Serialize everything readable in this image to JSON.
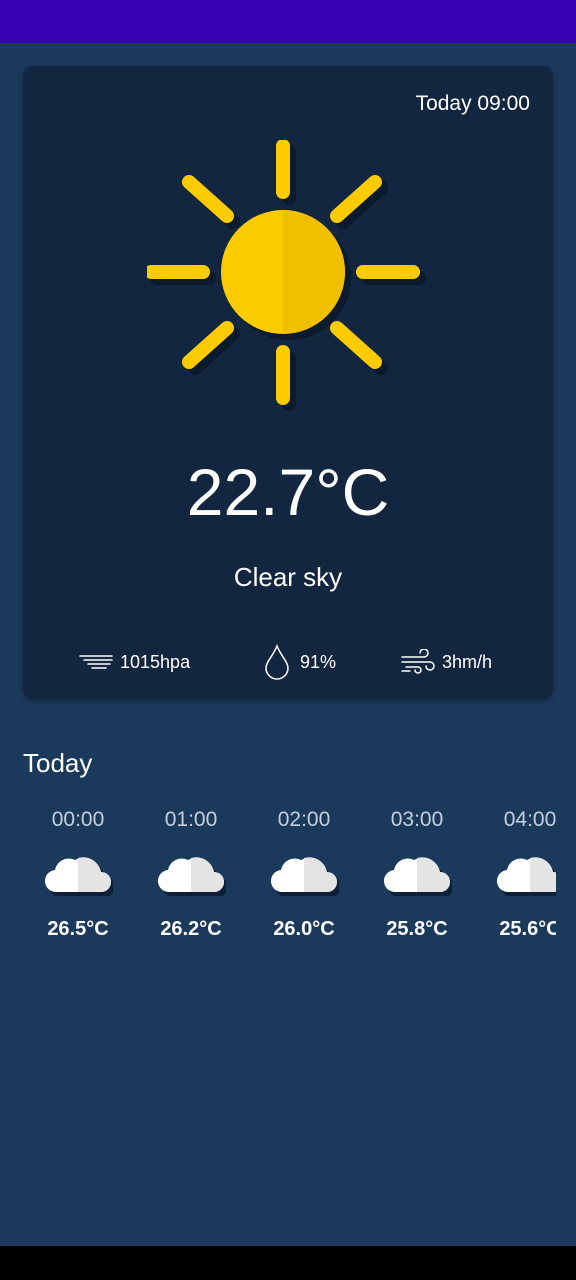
{
  "current": {
    "datetime": "Today 09:00",
    "weather_icon": "sun-icon",
    "temperature": "22.7°C",
    "condition": "Clear sky",
    "pressure": "1015hpa",
    "humidity": "91%",
    "wind": "3hm/h"
  },
  "hourly": {
    "title": "Today",
    "items": [
      {
        "time": "00:00",
        "icon": "cloud-icon",
        "temp": "26.5°C"
      },
      {
        "time": "01:00",
        "icon": "cloud-icon",
        "temp": "26.2°C"
      },
      {
        "time": "02:00",
        "icon": "cloud-icon",
        "temp": "26.0°C"
      },
      {
        "time": "03:00",
        "icon": "cloud-icon",
        "temp": "25.8°C"
      },
      {
        "time": "04:00",
        "icon": "cloud-icon",
        "temp": "25.6°C"
      }
    ]
  },
  "colors": {
    "status_bar": "#3700b3",
    "background": "#1b3a5b",
    "card": "#13263f",
    "sun": "#fdcc00"
  }
}
